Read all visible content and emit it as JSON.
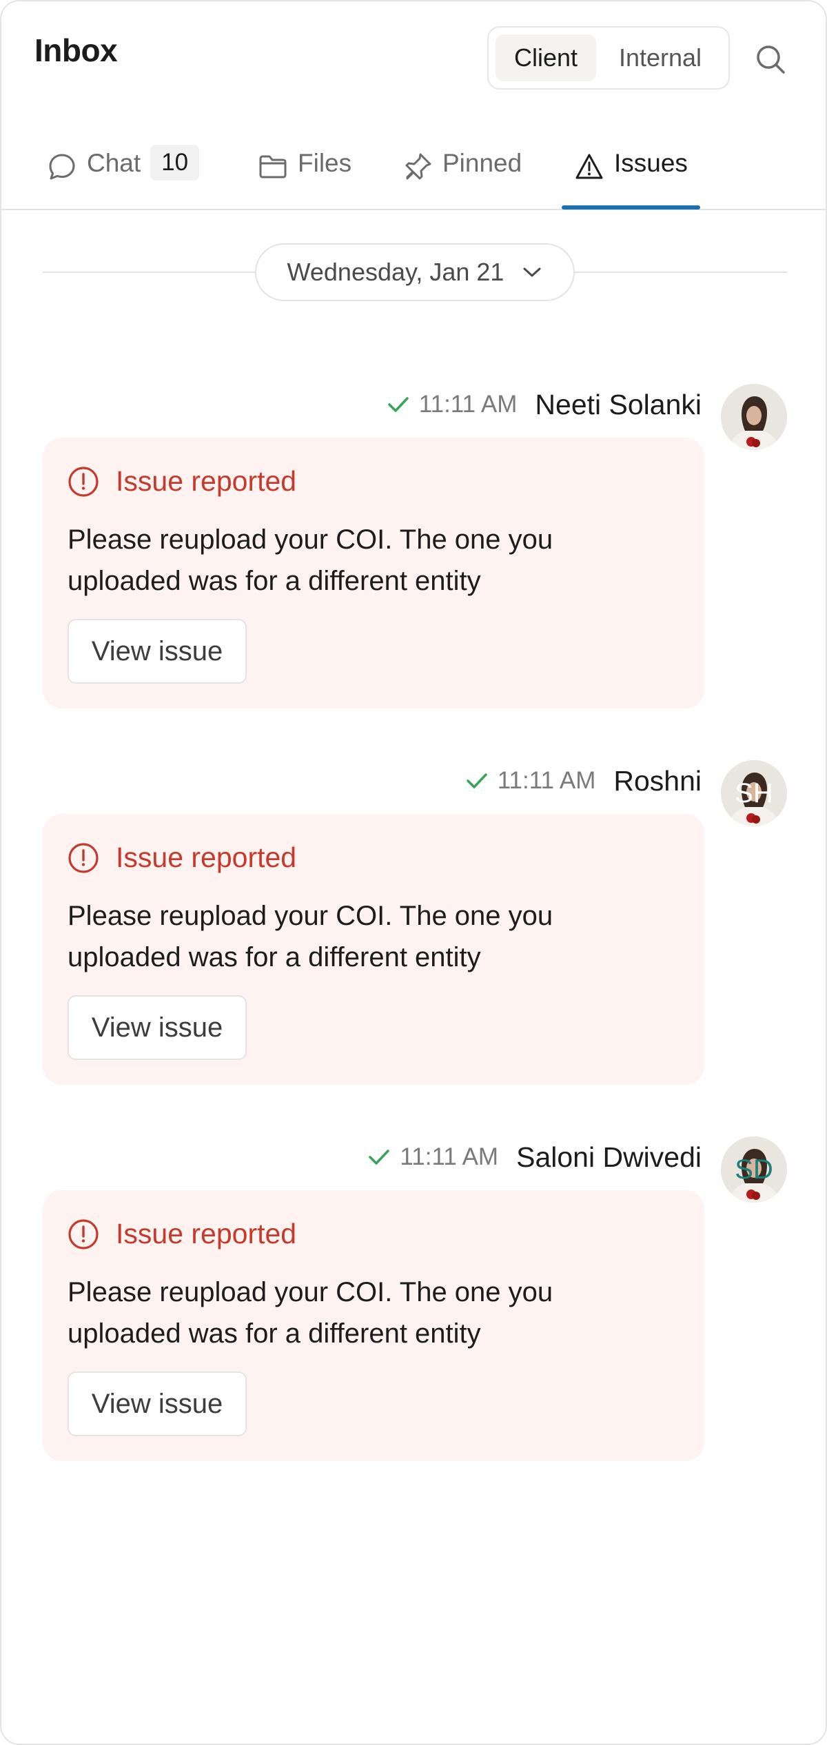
{
  "header": {
    "title": "Inbox",
    "segments": [
      {
        "label": "Client",
        "active": true
      },
      {
        "label": "Internal",
        "active": false
      }
    ],
    "search_icon": "search-icon"
  },
  "tabs": [
    {
      "label": "Chat",
      "icon": "chat-bubble-icon",
      "count": "10",
      "active": false
    },
    {
      "label": "Files",
      "icon": "folder-icon",
      "active": false
    },
    {
      "label": "Pinned",
      "icon": "pin-icon",
      "active": false
    },
    {
      "label": "Issues",
      "icon": "warning-icon",
      "active": true
    }
  ],
  "date_divider": {
    "label": "Wednesday, Jan 21",
    "icon": "chevron-down-icon"
  },
  "messages": [
    {
      "time": "11:11 AM",
      "sender": "Neeti Solanki",
      "avatar_initials": "",
      "issue_title": "Issue reported",
      "body": "Please reupload your COI. The one you uploaded was for a different entity",
      "button": "View issue"
    },
    {
      "time": "11:11 AM",
      "sender": "Roshni",
      "avatar_initials": "SH",
      "issue_title": "Issue reported",
      "body": "Please reupload your COI. The one you uploaded was for a different entity",
      "button": "View issue"
    },
    {
      "time": "11:11 AM",
      "sender": "Saloni Dwivedi",
      "avatar_initials": "SD",
      "issue_title": "Issue reported",
      "body": "Please reupload your COI. The one you uploaded was for a different entity",
      "button": "View issue"
    }
  ],
  "colors": {
    "accent_tab": "#1a6fb0",
    "issue_red": "#c63a2c",
    "issue_bg": "#fef3f1",
    "check_green": "#3aa35a"
  }
}
